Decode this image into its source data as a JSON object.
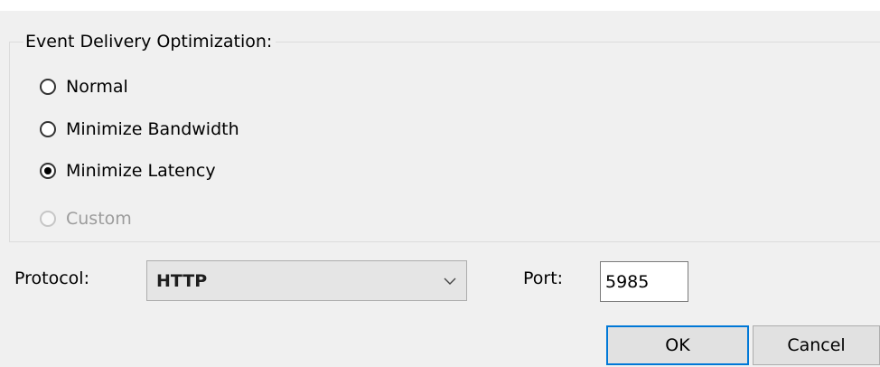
{
  "group": {
    "title": "Event Delivery Optimization:",
    "options": [
      {
        "label": "Normal",
        "checked": false,
        "enabled": true
      },
      {
        "label": "Minimize Bandwidth",
        "checked": false,
        "enabled": true
      },
      {
        "label": "Minimize Latency",
        "checked": true,
        "enabled": true
      },
      {
        "label": "Custom",
        "checked": false,
        "enabled": false
      }
    ]
  },
  "protocol": {
    "label": "Protocol:",
    "value": "HTTP"
  },
  "port": {
    "label": "Port:",
    "value": "5985"
  },
  "buttons": {
    "ok": "OK",
    "cancel": "Cancel"
  },
  "colors": {
    "background": "#f0f0f0",
    "default_button_border": "#0078d7",
    "disabled_text": "#9c9c9c"
  },
  "icons": {
    "combo_arrow": "chevron-down-icon"
  }
}
